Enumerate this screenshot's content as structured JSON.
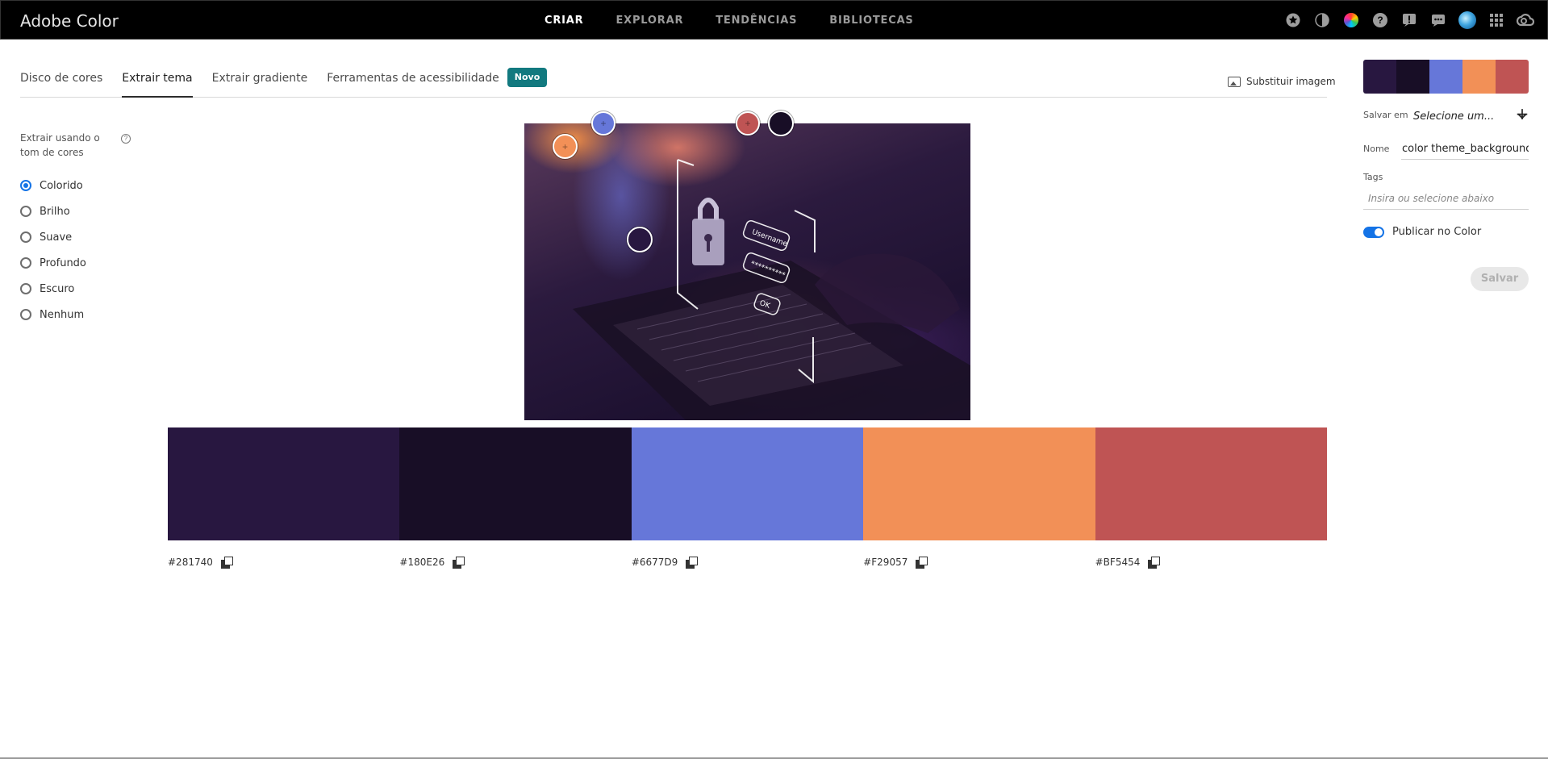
{
  "app": {
    "title": "Adobe Color"
  },
  "nav": [
    {
      "label": "CRIAR",
      "active": true
    },
    {
      "label": "EXPLORAR",
      "active": false
    },
    {
      "label": "TENDÊNCIAS",
      "active": false
    },
    {
      "label": "BIBLIOTECAS",
      "active": false
    }
  ],
  "top_icons": [
    "star-icon",
    "contrast-icon",
    "color-wheel-icon",
    "help-icon",
    "alert-icon",
    "feedback-icon",
    "avatar",
    "apps-grid-icon",
    "creative-cloud-icon"
  ],
  "tabs": [
    {
      "label": "Disco de cores",
      "active": false
    },
    {
      "label": "Extrair tema",
      "active": true
    },
    {
      "label": "Extrair gradiente",
      "active": false
    },
    {
      "label": "Ferramentas de acessibilidade",
      "active": false
    }
  ],
  "badge_new": "Novo",
  "replace_image": "Substituir imagem",
  "mood": {
    "label": "Extrair usando o tom de cores",
    "options": [
      {
        "label": "Colorido",
        "checked": true
      },
      {
        "label": "Brilho",
        "checked": false
      },
      {
        "label": "Suave",
        "checked": false
      },
      {
        "label": "Profundo",
        "checked": false
      },
      {
        "label": "Escuro",
        "checked": false
      },
      {
        "label": "Nenhum",
        "checked": false
      }
    ]
  },
  "image_overlay": {
    "field_username": "Username",
    "field_password": "**********",
    "button_ok": "OK"
  },
  "swatches": [
    {
      "hex": "#281740",
      "color": "#281740"
    },
    {
      "hex": "#180E26",
      "color": "#180E26"
    },
    {
      "hex": "#6677D9",
      "color": "#6677D9"
    },
    {
      "hex": "#F29057",
      "color": "#F29057"
    },
    {
      "hex": "#BF5454",
      "color": "#BF5454"
    }
  ],
  "right_panel": {
    "save_in_label": "Salvar em",
    "save_in_value": "Selecione um...",
    "name_label": "Nome",
    "name_value": "color theme_background",
    "tags_label": "Tags",
    "tags_placeholder": "Insira ou selecione abaixo",
    "publish_label": "Publicar no Color",
    "publish_on": true,
    "save_button": "Salvar"
  }
}
